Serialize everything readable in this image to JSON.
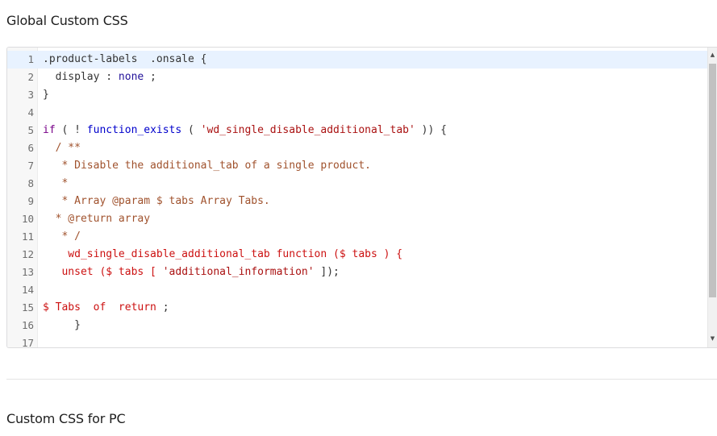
{
  "sections": {
    "global_title": "Global Custom CSS",
    "pc_title": "Custom CSS for PC"
  },
  "editor": {
    "lines": [
      {
        "num": "1",
        "tokens": [
          {
            "t": ".product-labels  .onsale {",
            "c": "def"
          }
        ]
      },
      {
        "num": "2",
        "tokens": [
          {
            "t": "  display : ",
            "c": "def"
          },
          {
            "t": "none",
            "c": "atom"
          },
          {
            "t": " ;",
            "c": "def"
          }
        ]
      },
      {
        "num": "3",
        "tokens": [
          {
            "t": "}",
            "c": "def"
          }
        ]
      },
      {
        "num": "4",
        "tokens": []
      },
      {
        "num": "5",
        "tokens": [
          {
            "t": "if",
            "c": "kw"
          },
          {
            "t": " ( ! ",
            "c": "def"
          },
          {
            "t": "function_exists",
            "c": "fn"
          },
          {
            "t": " ( ",
            "c": "def"
          },
          {
            "t": "'wd_single_disable_additional_tab'",
            "c": "str"
          },
          {
            "t": " )) {",
            "c": "def"
          }
        ]
      },
      {
        "num": "6",
        "tokens": [
          {
            "t": "  / **",
            "c": "com"
          }
        ]
      },
      {
        "num": "7",
        "tokens": [
          {
            "t": "   * Disable the additional_tab of a single product.",
            "c": "com"
          }
        ]
      },
      {
        "num": "8",
        "tokens": [
          {
            "t": "   *",
            "c": "com"
          }
        ]
      },
      {
        "num": "9",
        "tokens": [
          {
            "t": "   * Array @param $ tabs Array Tabs.",
            "c": "com"
          }
        ]
      },
      {
        "num": "10",
        "tokens": [
          {
            "t": "  * @return array",
            "c": "com"
          }
        ]
      },
      {
        "num": "11",
        "tokens": [
          {
            "t": "   * /",
            "c": "com"
          }
        ]
      },
      {
        "num": "12",
        "tokens": [
          {
            "t": "    wd_single_disable_additional_tab function ($ tabs ) {",
            "c": "red"
          }
        ]
      },
      {
        "num": "13",
        "tokens": [
          {
            "t": "   unset ($ tabs [ ",
            "c": "red"
          },
          {
            "t": "'additional_information'",
            "c": "str"
          },
          {
            "t": " ]);",
            "c": "def"
          }
        ]
      },
      {
        "num": "14",
        "tokens": []
      },
      {
        "num": "15",
        "tokens": [
          {
            "t": "$ Tabs  of  return",
            "c": "red"
          },
          {
            "t": " ;",
            "c": "def"
          }
        ]
      },
      {
        "num": "16",
        "tokens": [
          {
            "t": "     }",
            "c": "def"
          }
        ]
      },
      {
        "num": "17",
        "tokens": []
      }
    ]
  },
  "scrollbar": {
    "up_icon": "triangle-up-icon",
    "down_icon": "triangle-down-icon",
    "up_glyph": "▲",
    "down_glyph": "▼"
  },
  "colors": {
    "keyword": "#770088",
    "function": "#0000cc",
    "string": "#aa1111",
    "comment": "#a0522d",
    "active_line": "#e8f2ff"
  }
}
